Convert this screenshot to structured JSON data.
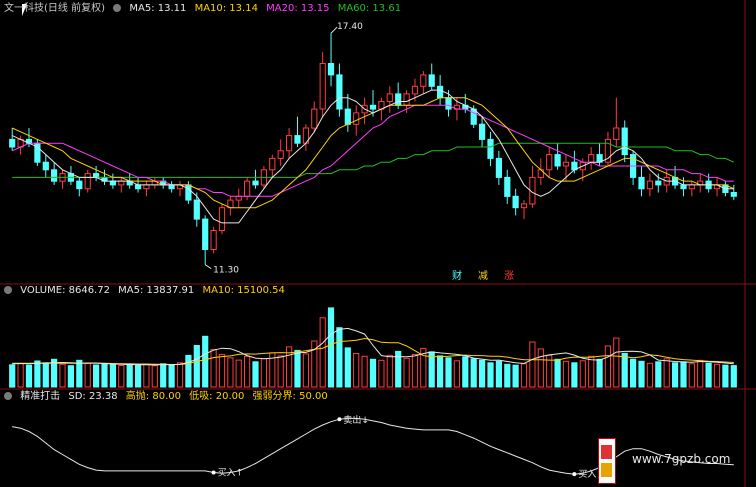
{
  "main_header": {
    "title": "文一科技(日线 前复权)",
    "ma5": "MA5: 13.11",
    "ma10": "MA10: 13.14",
    "ma20": "MA20: 13.15",
    "ma60": "MA60: 13.61"
  },
  "price_annotations": {
    "high_label": "17.40",
    "low_label": "11.30",
    "news_labels": [
      "财",
      "减",
      "涨"
    ]
  },
  "volume_header": {
    "title": "VOLUME: 8646.72",
    "ma5": "MA5: 13837.91",
    "ma10": "MA10: 15100.54"
  },
  "indicator_header": {
    "title": "精准打击",
    "sd": "SD: 23.38",
    "high": "高抛: 80.00",
    "low": "低吸: 20.00",
    "divide": "强弱分界: 50.00"
  },
  "indicator_annotations": {
    "sell_label": "卖出↓",
    "buy_labels": [
      "买入↑",
      "买入↑"
    ]
  },
  "watermark": "www.7gpzb.com",
  "colors": {
    "up": "#ff3c3c",
    "down": "#54ffff",
    "ma5": "#e8e8e8",
    "ma10": "#ffd200",
    "ma20": "#ff3cff",
    "ma60": "#20c020",
    "divider": "#8a1010",
    "sd_line": "#e8e8e8"
  },
  "chart_data": [
    {
      "type": "candlestick",
      "candles": [
        [
          14.6,
          14.9,
          14.3,
          14.4
        ],
        [
          14.4,
          14.7,
          14.2,
          14.6
        ],
        [
          14.6,
          14.9,
          14.4,
          14.5
        ],
        [
          14.5,
          14.6,
          13.9,
          14.0
        ],
        [
          14.0,
          14.2,
          13.6,
          13.8
        ],
        [
          13.8,
          14.0,
          13.4,
          13.5
        ],
        [
          13.5,
          13.8,
          13.3,
          13.7
        ],
        [
          13.7,
          13.9,
          13.4,
          13.5
        ],
        [
          13.5,
          13.6,
          13.1,
          13.3
        ],
        [
          13.3,
          13.8,
          13.2,
          13.7
        ],
        [
          13.7,
          13.9,
          13.5,
          13.6
        ],
        [
          13.6,
          13.8,
          13.4,
          13.5
        ],
        [
          13.5,
          13.7,
          13.3,
          13.4
        ],
        [
          13.4,
          13.6,
          13.2,
          13.5
        ],
        [
          13.5,
          13.7,
          13.3,
          13.4
        ],
        [
          13.4,
          13.6,
          13.2,
          13.3
        ],
        [
          13.3,
          13.5,
          13.1,
          13.4
        ],
        [
          13.4,
          13.6,
          13.3,
          13.5
        ],
        [
          13.5,
          13.6,
          13.3,
          13.4
        ],
        [
          13.4,
          13.5,
          13.2,
          13.3
        ],
        [
          13.3,
          13.5,
          13.1,
          13.4
        ],
        [
          13.4,
          13.5,
          12.9,
          13.0
        ],
        [
          13.0,
          13.2,
          12.3,
          12.5
        ],
        [
          12.5,
          12.6,
          11.3,
          11.7
        ],
        [
          11.7,
          12.3,
          11.6,
          12.2
        ],
        [
          12.2,
          12.9,
          12.1,
          12.8
        ],
        [
          12.8,
          13.1,
          12.6,
          13.0
        ],
        [
          13.0,
          13.3,
          12.8,
          13.1
        ],
        [
          13.1,
          13.6,
          13.0,
          13.5
        ],
        [
          13.5,
          13.8,
          13.3,
          13.4
        ],
        [
          13.4,
          13.9,
          13.3,
          13.8
        ],
        [
          13.8,
          14.2,
          13.6,
          14.1
        ],
        [
          14.1,
          14.6,
          13.9,
          14.3
        ],
        [
          14.3,
          14.9,
          14.1,
          14.7
        ],
        [
          14.7,
          15.2,
          14.4,
          14.5
        ],
        [
          14.5,
          15.0,
          14.3,
          14.9
        ],
        [
          14.9,
          15.6,
          14.8,
          15.4
        ],
        [
          15.4,
          16.9,
          15.2,
          16.6
        ],
        [
          16.6,
          17.4,
          16.0,
          16.3
        ],
        [
          16.3,
          16.6,
          15.2,
          15.4
        ],
        [
          15.4,
          15.8,
          14.8,
          15.0
        ],
        [
          15.0,
          15.5,
          14.7,
          15.3
        ],
        [
          15.3,
          15.7,
          15.0,
          15.5
        ],
        [
          15.5,
          15.9,
          15.2,
          15.4
        ],
        [
          15.4,
          15.7,
          15.1,
          15.6
        ],
        [
          15.6,
          16.0,
          15.3,
          15.8
        ],
        [
          15.8,
          16.1,
          15.4,
          15.5
        ],
        [
          15.5,
          15.9,
          15.3,
          15.8
        ],
        [
          15.8,
          16.2,
          15.6,
          16.0
        ],
        [
          16.0,
          16.4,
          15.8,
          16.3
        ],
        [
          16.3,
          16.6,
          15.9,
          16.0
        ],
        [
          16.0,
          16.3,
          15.5,
          15.7
        ],
        [
          15.7,
          15.9,
          15.2,
          15.4
        ],
        [
          15.4,
          15.7,
          15.1,
          15.5
        ],
        [
          15.5,
          15.8,
          15.3,
          15.4
        ],
        [
          15.4,
          15.5,
          14.9,
          15.0
        ],
        [
          15.0,
          15.2,
          14.4,
          14.6
        ],
        [
          14.6,
          14.8,
          13.9,
          14.1
        ],
        [
          14.1,
          14.3,
          13.4,
          13.6
        ],
        [
          13.6,
          13.8,
          12.9,
          13.1
        ],
        [
          13.1,
          13.3,
          12.6,
          12.8
        ],
        [
          12.8,
          13.0,
          12.5,
          12.9
        ],
        [
          12.9,
          13.9,
          12.8,
          13.6
        ],
        [
          13.6,
          14.1,
          13.4,
          13.8
        ],
        [
          13.8,
          14.4,
          13.6,
          14.2
        ],
        [
          14.2,
          14.5,
          13.8,
          13.9
        ],
        [
          13.9,
          14.2,
          13.5,
          14.0
        ],
        [
          14.0,
          14.3,
          13.7,
          13.8
        ],
        [
          13.8,
          14.1,
          13.5,
          14.0
        ],
        [
          14.0,
          14.4,
          13.8,
          14.2
        ],
        [
          14.2,
          14.5,
          13.9,
          14.0
        ],
        [
          14.0,
          14.8,
          13.9,
          14.6
        ],
        [
          14.6,
          15.7,
          14.4,
          14.9
        ],
        [
          14.9,
          15.1,
          14.0,
          14.2
        ],
        [
          14.2,
          14.3,
          13.4,
          13.6
        ],
        [
          13.6,
          13.9,
          13.1,
          13.3
        ],
        [
          13.3,
          13.7,
          13.1,
          13.5
        ],
        [
          13.5,
          13.7,
          13.2,
          13.4
        ],
        [
          13.4,
          13.8,
          13.2,
          13.6
        ],
        [
          13.6,
          13.9,
          13.3,
          13.4
        ],
        [
          13.4,
          13.6,
          13.1,
          13.3
        ],
        [
          13.3,
          13.5,
          13.1,
          13.4
        ],
        [
          13.4,
          13.7,
          13.2,
          13.5
        ],
        [
          13.5,
          13.7,
          13.2,
          13.3
        ],
        [
          13.3,
          13.6,
          13.1,
          13.4
        ],
        [
          13.4,
          13.5,
          13.1,
          13.2
        ],
        [
          13.2,
          13.4,
          13.0,
          13.1
        ]
      ],
      "ma5": [
        14.7,
        14.6,
        14.5,
        14.4,
        14.2,
        14.0,
        13.8,
        13.7,
        13.6,
        13.6,
        13.6,
        13.5,
        13.5,
        13.5,
        13.5,
        13.4,
        13.4,
        13.4,
        13.4,
        13.4,
        13.4,
        13.3,
        13.1,
        12.8,
        12.5,
        12.4,
        12.4,
        12.4,
        12.7,
        13.0,
        13.3,
        13.6,
        13.8,
        14.1,
        14.3,
        14.5,
        14.8,
        15.2,
        15.5,
        15.7,
        15.7,
        15.6,
        15.4,
        15.3,
        15.4,
        15.5,
        15.6,
        15.6,
        15.7,
        15.8,
        15.9,
        15.9,
        15.8,
        15.6,
        15.5,
        15.4,
        15.2,
        14.9,
        14.6,
        14.2,
        13.8,
        13.4,
        13.2,
        13.1,
        13.2,
        13.4,
        13.6,
        13.8,
        13.9,
        14.0,
        14.0,
        14.1,
        14.3,
        14.4,
        14.3,
        14.1,
        13.8,
        13.6,
        13.5,
        13.5,
        13.4,
        13.4,
        13.4,
        13.4,
        13.4,
        13.3,
        13.3
      ],
      "ma10": [
        14.9,
        14.8,
        14.7,
        14.6,
        14.5,
        14.4,
        14.3,
        14.1,
        14.0,
        13.9,
        13.8,
        13.7,
        13.6,
        13.6,
        13.5,
        13.5,
        13.5,
        13.5,
        13.4,
        13.4,
        13.4,
        13.4,
        13.3,
        13.2,
        13.0,
        12.9,
        12.8,
        12.8,
        12.8,
        12.8,
        12.9,
        13.0,
        13.2,
        13.4,
        13.6,
        13.8,
        14.1,
        14.4,
        14.7,
        14.9,
        15.0,
        15.1,
        15.2,
        15.3,
        15.4,
        15.5,
        15.5,
        15.5,
        15.5,
        15.5,
        15.6,
        15.7,
        15.7,
        15.7,
        15.7,
        15.6,
        15.5,
        15.3,
        15.1,
        14.9,
        14.6,
        14.3,
        14.0,
        13.8,
        13.6,
        13.5,
        13.5,
        13.5,
        13.6,
        13.7,
        13.8,
        13.9,
        14.0,
        14.1,
        14.1,
        14.0,
        13.9,
        13.8,
        13.7,
        13.6,
        13.5,
        13.5,
        13.4,
        13.4,
        13.4,
        13.4,
        13.3
      ],
      "ma20": [
        14.3,
        14.4,
        14.5,
        14.5,
        14.5,
        14.5,
        14.5,
        14.4,
        14.3,
        14.2,
        14.1,
        14.0,
        13.9,
        13.8,
        13.7,
        13.6,
        13.6,
        13.5,
        13.5,
        13.4,
        13.4,
        13.4,
        13.3,
        13.3,
        13.2,
        13.2,
        13.1,
        13.1,
        13.1,
        13.1,
        13.1,
        13.1,
        13.2,
        13.3,
        13.4,
        13.5,
        13.6,
        13.8,
        13.9,
        14.1,
        14.3,
        14.5,
        14.7,
        14.9,
        15.0,
        15.2,
        15.3,
        15.4,
        15.5,
        15.5,
        15.5,
        15.5,
        15.5,
        15.4,
        15.4,
        15.3,
        15.2,
        15.1,
        15.0,
        14.9,
        14.8,
        14.7,
        14.6,
        14.5,
        14.4,
        14.3,
        14.2,
        14.1,
        14.0,
        14.0,
        13.9,
        13.9,
        13.9,
        13.9,
        13.9,
        13.9,
        13.9,
        13.9,
        13.8,
        13.8,
        13.8,
        13.7,
        13.7,
        13.6,
        13.6,
        13.5,
        13.5
      ],
      "ma60": [
        13.6,
        13.6,
        13.6,
        13.6,
        13.6,
        13.6,
        13.6,
        13.6,
        13.6,
        13.6,
        13.6,
        13.6,
        13.6,
        13.6,
        13.6,
        13.6,
        13.6,
        13.6,
        13.6,
        13.6,
        13.6,
        13.6,
        13.6,
        13.6,
        13.6,
        13.6,
        13.6,
        13.6,
        13.6,
        13.6,
        13.6,
        13.6,
        13.6,
        13.6,
        13.6,
        13.7,
        13.7,
        13.7,
        13.7,
        13.8,
        13.8,
        13.8,
        13.9,
        13.9,
        14.0,
        14.0,
        14.1,
        14.1,
        14.2,
        14.2,
        14.3,
        14.3,
        14.3,
        14.4,
        14.4,
        14.4,
        14.4,
        14.4,
        14.5,
        14.5,
        14.5,
        14.5,
        14.5,
        14.5,
        14.5,
        14.5,
        14.5,
        14.5,
        14.5,
        14.5,
        14.5,
        14.5,
        14.4,
        14.4,
        14.4,
        14.4,
        14.4,
        14.4,
        14.4,
        14.3,
        14.3,
        14.3,
        14.2,
        14.2,
        14.1,
        14.1,
        14.0
      ],
      "ylim": [
        11.0,
        17.8
      ],
      "annotations": {
        "high": 17.4,
        "low": 11.3
      }
    },
    {
      "type": "bar",
      "name": "VOLUME",
      "values": [
        9000,
        9500,
        8800,
        10500,
        9800,
        11200,
        9200,
        8600,
        10800,
        9600,
        8900,
        9400,
        9100,
        8700,
        9300,
        8800,
        9200,
        8600,
        9400,
        9000,
        9800,
        12800,
        16800,
        20500,
        15200,
        13200,
        11800,
        10900,
        12400,
        10200,
        11500,
        13800,
        12600,
        16200,
        14800,
        13400,
        18600,
        28000,
        32000,
        24000,
        15800,
        13600,
        12400,
        11200,
        10800,
        12800,
        14400,
        11600,
        13200,
        15600,
        14200,
        12600,
        11800,
        10600,
        12200,
        11400,
        10800,
        9800,
        10400,
        9200,
        8800,
        9400,
        18200,
        15400,
        12800,
        11200,
        10400,
        9800,
        10600,
        12400,
        11200,
        16600,
        19800,
        13600,
        11200,
        10400,
        9600,
        10200,
        11400,
        9800,
        10200,
        9400,
        10800,
        9600,
        9200,
        8800,
        8646.72
      ],
      "ma5": [
        9400,
        9500,
        9400,
        9600,
        9700,
        9800,
        9900,
        9800,
        9600,
        9700,
        9700,
        9500,
        9300,
        9200,
        9100,
        9000,
        9000,
        8900,
        9100,
        9000,
        9200,
        9900,
        11300,
        13400,
        14900,
        15700,
        15500,
        14300,
        12700,
        11700,
        11400,
        11700,
        12100,
        12900,
        13800,
        14000,
        15100,
        17800,
        21400,
        23300,
        23700,
        22700,
        21400,
        16800,
        12700,
        12200,
        12300,
        12200,
        12600,
        13500,
        14200,
        13800,
        13500,
        13200,
        12700,
        11700,
        11300,
        10800,
        10900,
        10300,
        9800,
        9500,
        11200,
        12300,
        13000,
        13400,
        13800,
        12900,
        11600,
        11000,
        10900,
        12100,
        14100,
        14400,
        14500,
        14200,
        13000,
        10900,
        10600,
        10300,
        10100,
        10000,
        10300,
        10200,
        10000,
        9700,
        9400
      ],
      "ma10": [
        9600,
        9600,
        9600,
        9600,
        9600,
        9600,
        9600,
        9600,
        9600,
        9600,
        9600,
        9600,
        9500,
        9400,
        9400,
        9300,
        9300,
        9200,
        9200,
        9100,
        9100,
        9500,
        10300,
        11100,
        11900,
        12300,
        12600,
        13200,
        13400,
        13300,
        13600,
        13800,
        13900,
        13800,
        14200,
        14700,
        15300,
        15700,
        17200,
        18400,
        18600,
        18900,
        19600,
        19100,
        18100,
        17900,
        17900,
        16600,
        14700,
        12700,
        12200,
        12300,
        12400,
        12700,
        12900,
        12700,
        12700,
        12400,
        12400,
        12100,
        11500,
        11000,
        11000,
        11000,
        10900,
        10900,
        11700,
        12100,
        12000,
        12000,
        12400,
        12700,
        12500,
        12200,
        11800,
        12200,
        13000,
        12700,
        12000,
        11400,
        11100,
        10900,
        10600,
        10400,
        10300,
        10100,
        9900
      ],
      "ylim": [
        0,
        36000
      ]
    },
    {
      "type": "line",
      "name": "精准打击",
      "values": [
        70,
        68,
        64,
        58,
        50,
        42,
        36,
        30,
        24,
        20,
        17,
        16,
        16,
        16,
        16,
        16,
        16,
        16,
        16,
        16,
        16,
        16,
        16,
        16,
        14,
        13,
        14,
        16,
        20,
        25,
        31,
        37,
        43,
        49,
        55,
        61,
        67,
        72,
        76,
        79,
        80,
        80,
        79,
        77,
        75,
        72,
        70,
        68,
        67,
        66,
        66,
        66,
        66,
        64,
        60,
        56,
        51,
        46,
        42,
        38,
        34,
        30,
        26,
        21,
        17,
        15,
        13,
        12,
        13,
        16,
        20,
        26,
        33,
        40,
        43,
        43,
        40,
        36,
        33,
        30,
        28,
        27,
        26,
        25,
        25,
        24,
        23.38
      ],
      "ylim": [
        0,
        100
      ],
      "markers": {
        "sell_index": 39,
        "buy_indices": [
          24,
          67
        ]
      }
    }
  ]
}
